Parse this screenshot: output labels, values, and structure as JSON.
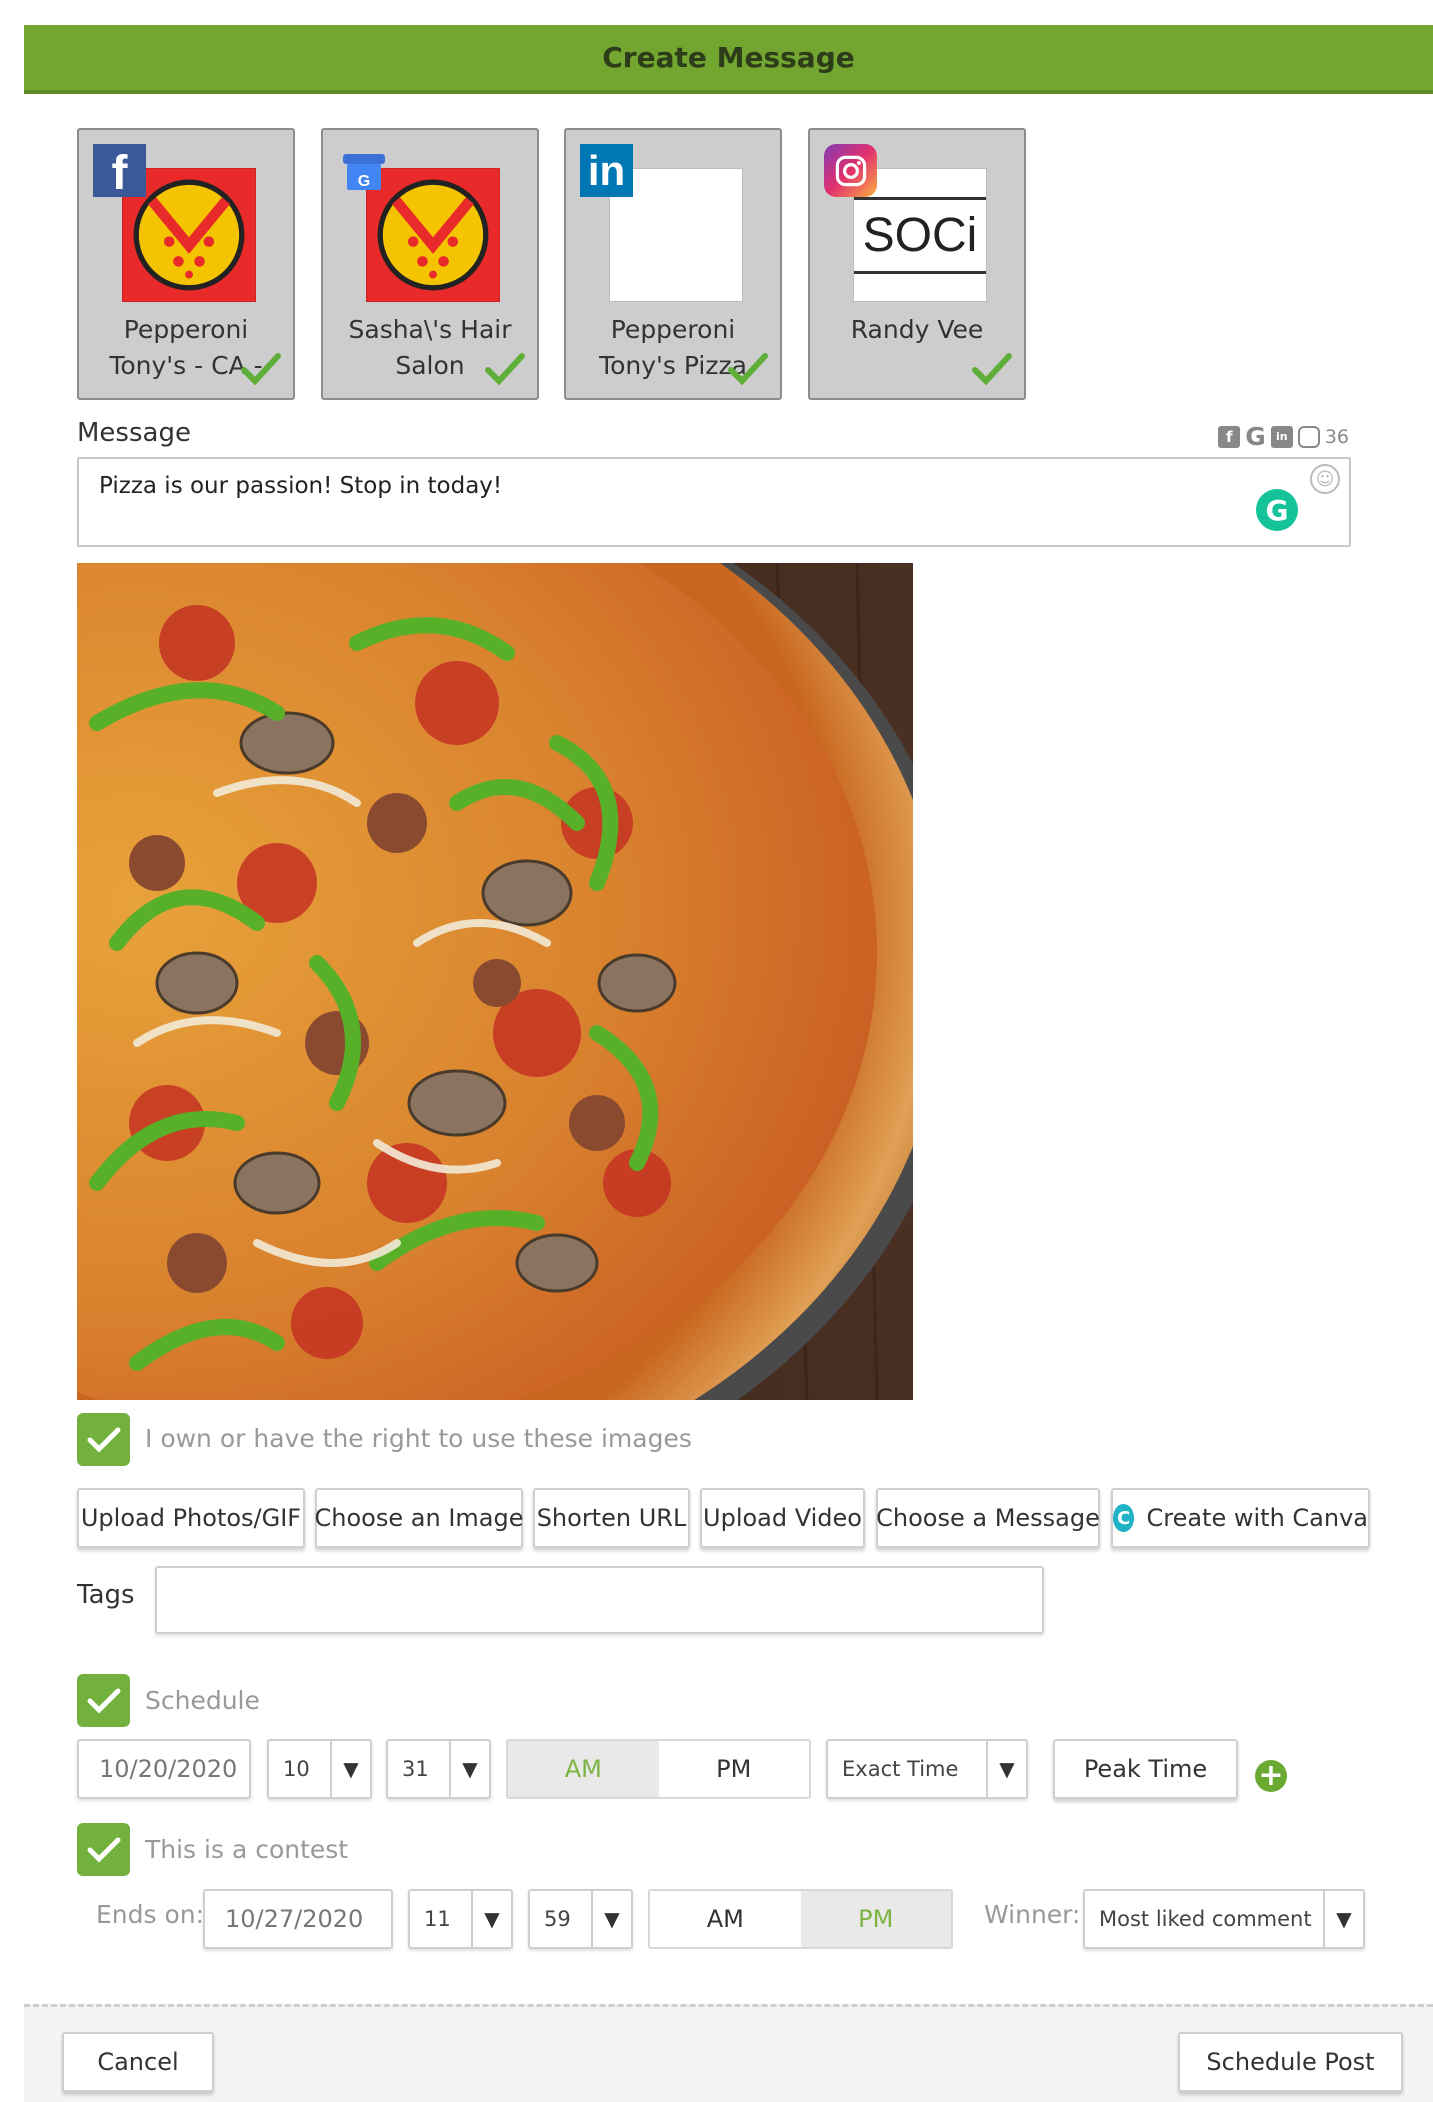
{
  "header": {
    "title": "Create Message"
  },
  "accounts": [
    {
      "network": "facebook",
      "name_line1": "Pepperoni",
      "name_line2": "Tony's - CA -",
      "selected": true
    },
    {
      "network": "google-my-business",
      "name_line1": "Sasha\\'s Hair",
      "name_line2": "Salon",
      "selected": true
    },
    {
      "network": "linkedin",
      "name_line1": "Pepperoni",
      "name_line2": "Tony's Pizza",
      "selected": true
    },
    {
      "network": "instagram",
      "name_line1": "Randy Vee",
      "name_line2": "",
      "selected": true
    }
  ],
  "soci_logo_text": "SOCi",
  "badges": {
    "facebook": "f",
    "linkedin": "in",
    "google": "G"
  },
  "message": {
    "label": "Message",
    "char_count": "36",
    "text": "Pizza is our passion! Stop in today!",
    "grammarly_glyph": "G",
    "emoji_glyph": "☺"
  },
  "rights_checkbox": {
    "label": "I own or have the right to use these images",
    "checked": true
  },
  "toolbar": {
    "upload_photos": "Upload Photos/GIF",
    "choose_image": "Choose an Image",
    "shorten_url": "Shorten URL",
    "upload_video": "Upload Video",
    "choose_message": "Choose a Message",
    "create_canva": "Create with Canva",
    "canva_glyph": "C"
  },
  "tags": {
    "label": "Tags",
    "value": ""
  },
  "schedule": {
    "label": "Schedule",
    "checked": true,
    "date": "10/20/2020",
    "hour": "10",
    "minute": "31",
    "am": "AM",
    "pm": "PM",
    "selected_period": "AM",
    "time_mode": "Exact Time",
    "peak_time": "Peak Time",
    "add_glyph": "+"
  },
  "contest": {
    "label": "This is a contest",
    "checked": true,
    "ends_on_label": "Ends on:",
    "date": "10/27/2020",
    "hour": "11",
    "minute": "59",
    "am": "AM",
    "pm": "PM",
    "selected_period": "PM",
    "winner_label": "Winner:",
    "winner_value": "Most liked comment"
  },
  "dropdown_arrow": "▼",
  "footer": {
    "cancel": "Cancel",
    "schedule_post": "Schedule Post"
  },
  "colors": {
    "brand_green": "#72a630",
    "check_green": "#72b13e",
    "selected_text": "#7cb342"
  }
}
